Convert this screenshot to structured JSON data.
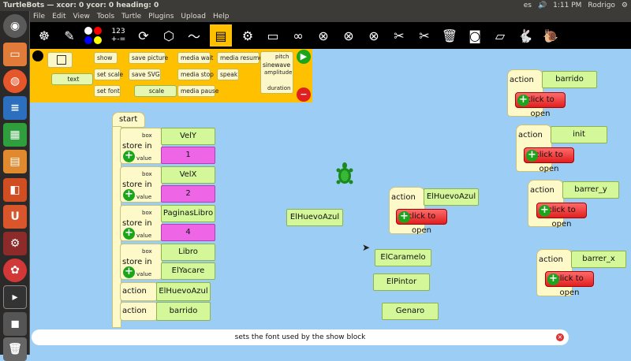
{
  "window": {
    "title": "TurtleBots — xcor: 0 ycor: 0 heading: 0"
  },
  "system": {
    "keyboard": "es",
    "time": "1:11 PM",
    "user": "Rodrigo"
  },
  "menu": [
    "File",
    "Edit",
    "View",
    "Tools",
    "Turtle",
    "Plugins",
    "Upload",
    "Help"
  ],
  "toolbar": {
    "counter": "123",
    "ops": "+-="
  },
  "palette": {
    "text": "text",
    "show": "show",
    "save_picture": "save picture",
    "media_wait": "media wait",
    "media_resume": "media resume",
    "set_scale": "set scale",
    "save_svg": "save SVG",
    "media_stop": "media stop",
    "speak": "speak",
    "set_font": "set font",
    "scale": "scale",
    "media_pause": "media pause",
    "sinewave": "sinewave",
    "pitch": "pitch",
    "amplitude": "amplitude",
    "duration": "duration"
  },
  "program": {
    "start": "start",
    "store_in": "store in",
    "box": "box",
    "value": "value",
    "stores": [
      {
        "name": "VelY",
        "value": "1"
      },
      {
        "name": "VelX",
        "value": "2"
      },
      {
        "name": "PaginasLibro",
        "value": "4"
      },
      {
        "name": "Libro",
        "value": "ElYacare"
      }
    ],
    "action": "action",
    "actions": [
      "ElHuevoAzul",
      "barrido"
    ]
  },
  "floating": {
    "elhuevo": "ElHuevoAzul",
    "elcaramelo": "ElCaramelo",
    "elpintor": "ElPintor",
    "genaro": "Genaro",
    "action": "action",
    "click_to_open": "click to open",
    "stacks": [
      "ElHuevoAzul",
      "barrido",
      "init",
      "barrer_y",
      "barrer_x"
    ]
  },
  "status": {
    "text": "sets the font used by the show block"
  }
}
